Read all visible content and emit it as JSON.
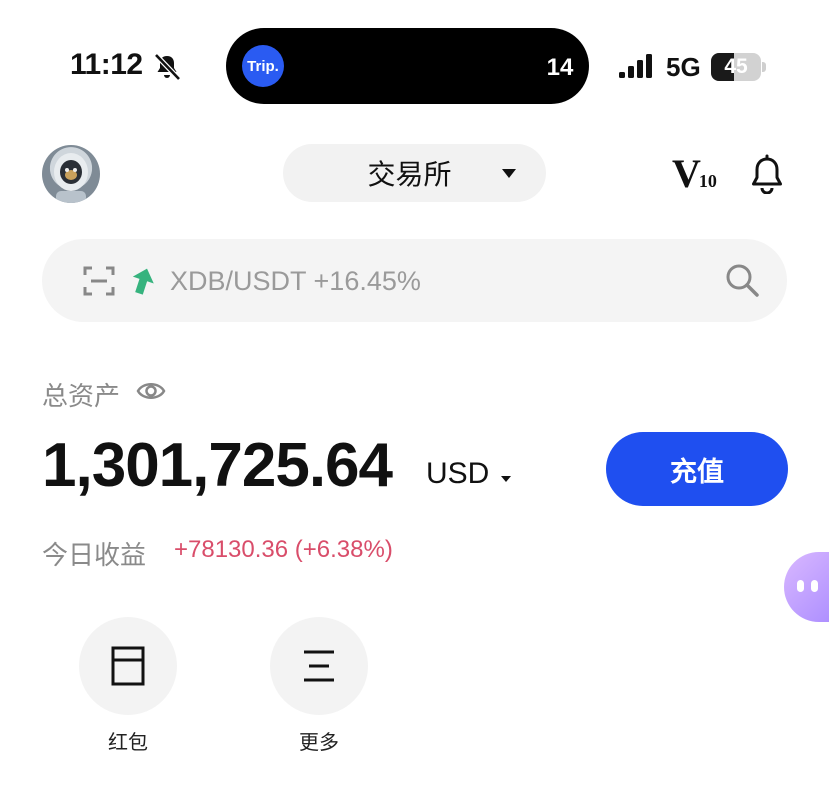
{
  "status_bar": {
    "time": "11:12",
    "island_app_logo": "Trip.",
    "island_value": "14",
    "network": "5G",
    "battery": "45",
    "battery_level": 0.45
  },
  "header": {
    "exchange_label": "交易所",
    "vip_letter": "V",
    "vip_level": "10"
  },
  "search": {
    "trending_text": "XDB/USDT +16.45%"
  },
  "assets": {
    "label": "总资产",
    "balance": "1,301,725.64",
    "currency": "USD",
    "deposit_label": "充值",
    "pnl_label": "今日收益",
    "pnl_value": "+78130.36 (+6.38%)"
  },
  "quick_actions": [
    {
      "label": "红包",
      "icon": "red-packet-icon"
    },
    {
      "label": "更多",
      "icon": "more-menu-icon"
    }
  ],
  "colors": {
    "accent": "#1f4ff0",
    "positive_arrow": "#36b37e",
    "pnl_positive": "#d94d6a"
  }
}
